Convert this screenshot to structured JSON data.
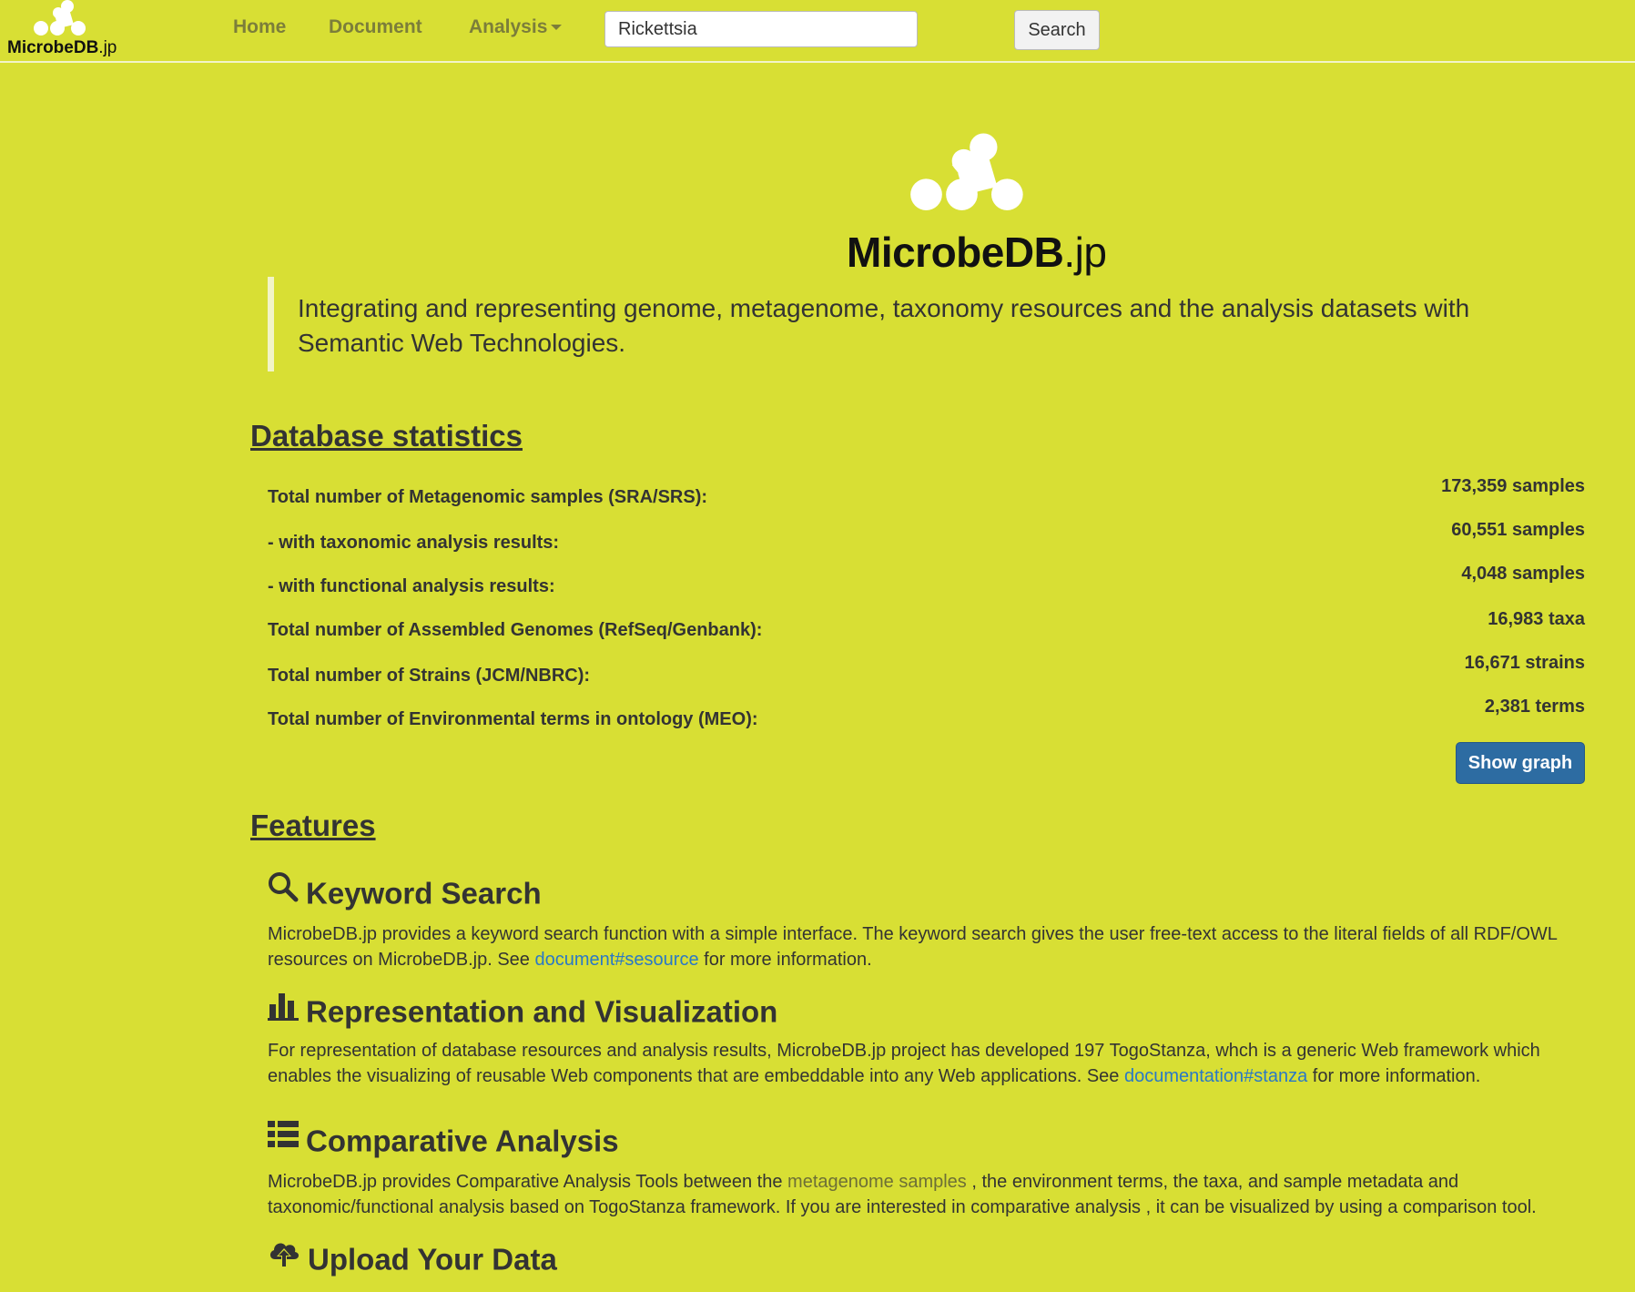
{
  "navbar": {
    "brand": {
      "bold": "MicrobeDB",
      "suffix": ".jp"
    },
    "links": {
      "home": "Home",
      "document": "Document",
      "analysis": "Analysis"
    },
    "search": {
      "value": "Rickettsia",
      "button": "Search"
    }
  },
  "hero": {
    "logo": {
      "bold": "MicrobeDB",
      "suffix": ".jp"
    },
    "tagline": "Integrating and representing genome, metagenome, taxonomy resources and the analysis datasets with Semantic Web Technologies."
  },
  "stats": {
    "title": "Database statistics",
    "rows": [
      {
        "label": "Total number of Metagenomic samples (SRA/SRS):",
        "value": "173,359 samples"
      },
      {
        "label": "- with taxonomic analysis results:",
        "value": "60,551 samples"
      },
      {
        "label": "- with functional analysis results:",
        "value": "4,048 samples"
      },
      {
        "label": "Total number of Assembled Genomes (RefSeq/Genbank):",
        "value": "16,983 taxa"
      },
      {
        "label": "Total number of Strains (JCM/NBRC):",
        "value": "16,671 strains"
      },
      {
        "label": "Total number of Environmental terms in ontology (MEO):",
        "value": "2,381 terms"
      }
    ],
    "show_graph": "Show graph"
  },
  "features": {
    "title": "Features",
    "items": [
      {
        "icon": "search-icon",
        "title": "Keyword Search",
        "text_before": "MicrobeDB.jp provides a keyword search function with a simple interface. The keyword search gives the user free-text access to the literal fields of all RDF/OWL resources on MicrobeDB.jp. See ",
        "link": "document#sesource",
        "text_after": " for more information."
      },
      {
        "icon": "bar-chart-icon",
        "title": "Representation and Visualization",
        "text_before": "For representation of database resources and analysis results, MicrobeDB.jp project has developed 197 TogoStanza, whch is a generic Web framework which enables the visualizing of reusable Web components that are embeddable into any Web applications. See ",
        "link": "documentation#stanza",
        "text_after": " for more information."
      },
      {
        "icon": "list-icon",
        "title": "Comparative Analysis",
        "text_before": "MicrobeDB.jp provides Comparative Analysis Tools between the ",
        "link": "metagenome samples",
        "text_after": " , the environment terms, the taxa, and sample metadata and taxonomic/functional analysis based on TogoStanza framework. If you are interested in comparative analysis , it can be visualized by using a comparison tool."
      },
      {
        "icon": "cloud-upload-icon",
        "title": "Upload Your Data"
      }
    ]
  },
  "colors": {
    "background": "#d8df34",
    "button_primary": "#2d6ca2",
    "link": "#2a78c6"
  }
}
